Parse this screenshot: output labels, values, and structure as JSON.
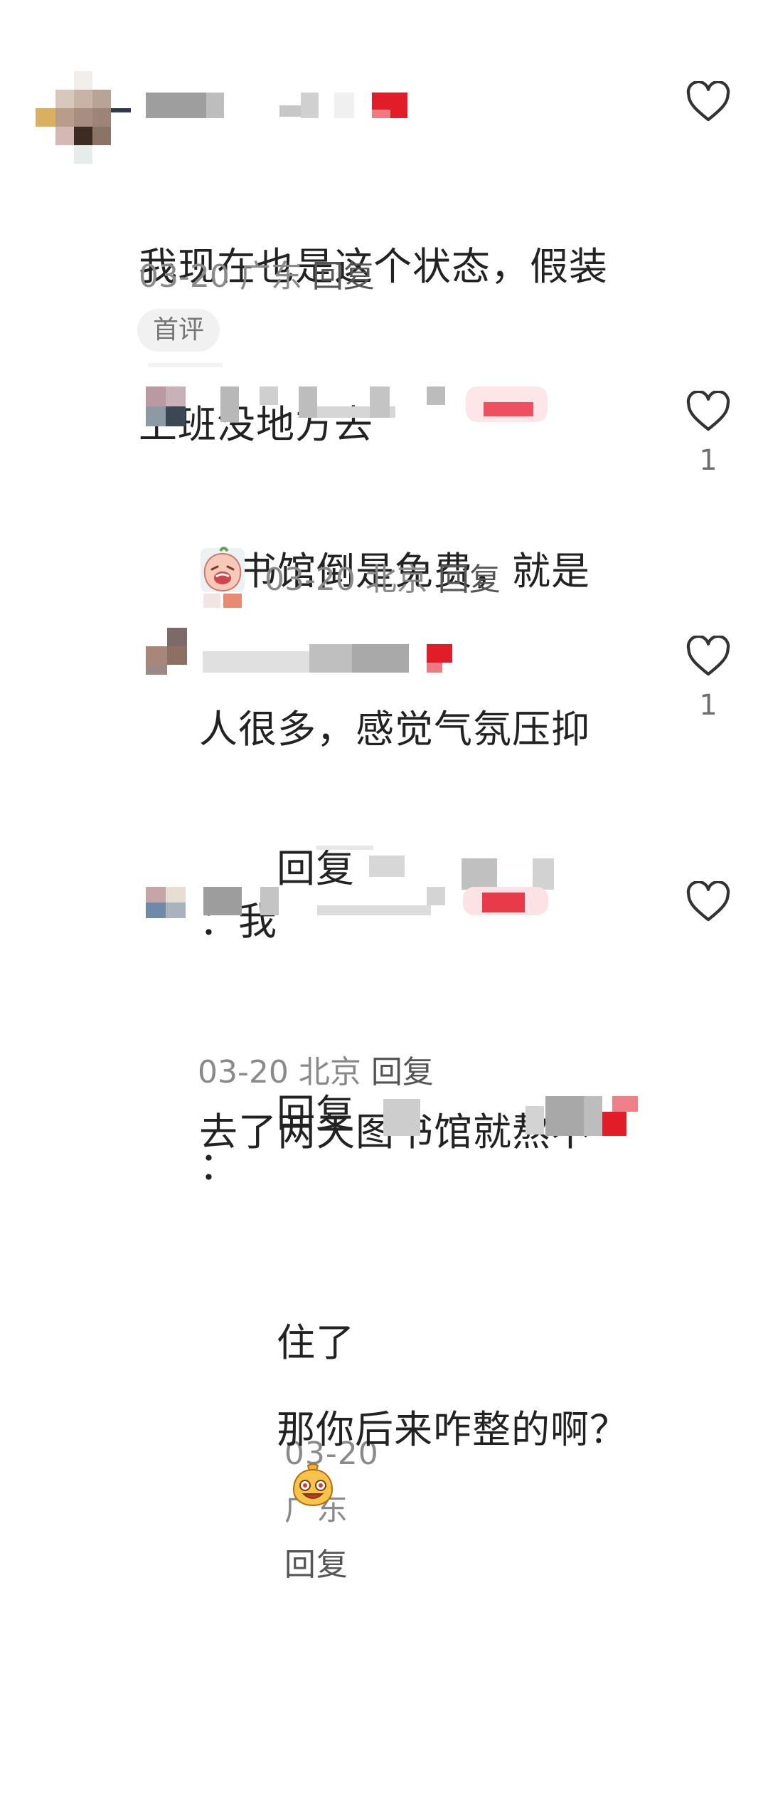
{
  "colors": {
    "heart_stroke": "#333333",
    "meta_gray": "#8a8a8a",
    "tag_bg": "#f1f1f1"
  },
  "comments": [
    {
      "text_line1": "我现在也是这个状态，假装",
      "text_line2": "上班没地方去",
      "date": "03-20",
      "location": "广东",
      "reply_label": "回复",
      "tag": "首评",
      "likes": ""
    },
    {
      "text_line1": "图书馆倒是免费，就是",
      "text_line2": "人很多，感觉气氛压抑",
      "date": "03-20",
      "location": "北京",
      "reply_label": "回复",
      "sticker": "crying-face-sticker",
      "likes": "1"
    },
    {
      "reply_prefix": "回复",
      "colon": "：我",
      "text_line2": "去了两天图书馆就熬不",
      "text_line3": "住了",
      "date": "03-20",
      "location": "广东",
      "reply_label": "回复",
      "likes": "1"
    },
    {
      "reply_prefix": "回复",
      "colon": "：",
      "text_line2": "那你后来咋整的啊？",
      "sticker": "grinning-face-sticker",
      "date": "03-20",
      "location": "北京",
      "reply_label": "回复",
      "likes": ""
    }
  ]
}
